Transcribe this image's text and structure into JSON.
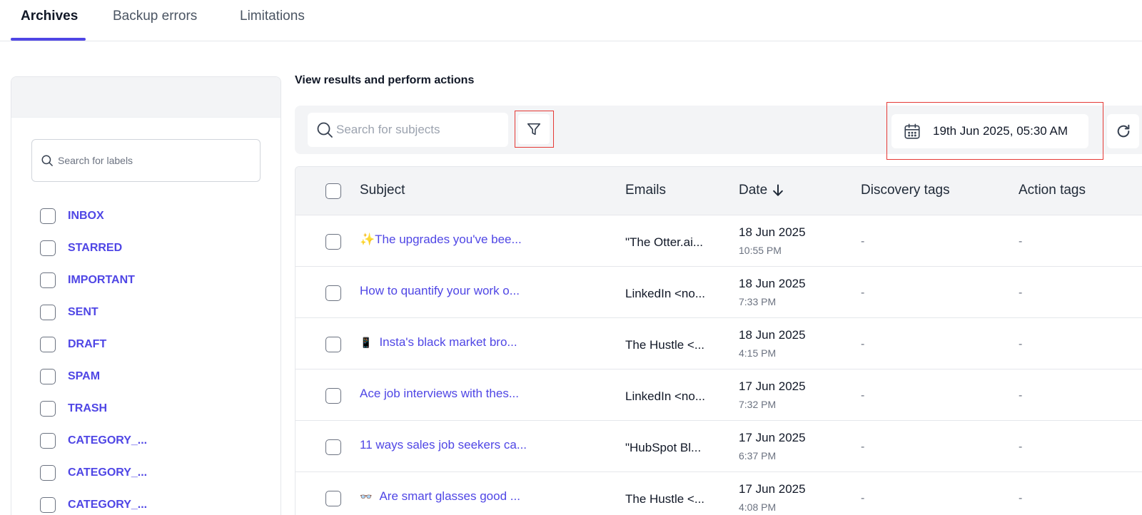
{
  "tabs": [
    {
      "label": "Archives",
      "active": true
    },
    {
      "label": "Backup errors",
      "active": false
    },
    {
      "label": "Limitations",
      "active": false
    }
  ],
  "sidebar": {
    "search_placeholder": "Search for labels",
    "labels": [
      "INBOX",
      "STARRED",
      "IMPORTANT",
      "SENT",
      "DRAFT",
      "SPAM",
      "TRASH",
      "CATEGORY_...",
      "CATEGORY_...",
      "CATEGORY_..."
    ]
  },
  "main": {
    "title": "View results and perform actions",
    "search_placeholder": "Search for subjects",
    "date_value": "19th Jun 2025, 05:30 AM"
  },
  "table": {
    "columns": {
      "subject": "Subject",
      "emails": "Emails",
      "date": "Date",
      "discovery": "Discovery tags",
      "action": "Action tags"
    },
    "rows": [
      {
        "icon": "✨",
        "subject": "The upgrades you've bee...",
        "email": "\"The Otter.ai...",
        "date": "18 Jun 2025",
        "time": "10:55 PM",
        "discovery": "-",
        "action": "-"
      },
      {
        "icon": "",
        "subject": "How to quantify your work o...",
        "email": "LinkedIn <no...",
        "date": "18 Jun 2025",
        "time": "7:33 PM",
        "discovery": "-",
        "action": "-"
      },
      {
        "icon": "📱",
        "subject": "Insta's black market bro...",
        "email": "The Hustle <...",
        "date": "18 Jun 2025",
        "time": "4:15 PM",
        "discovery": "-",
        "action": "-"
      },
      {
        "icon": "",
        "subject": "Ace job interviews with thes...",
        "email": "LinkedIn <no...",
        "date": "17 Jun 2025",
        "time": "7:32 PM",
        "discovery": "-",
        "action": "-"
      },
      {
        "icon": "",
        "subject": "11 ways sales job seekers ca...",
        "email": "\"HubSpot Bl...",
        "date": "17 Jun 2025",
        "time": "6:37 PM",
        "discovery": "-",
        "action": "-"
      },
      {
        "icon": "👓",
        "subject": "Are smart glasses good ...",
        "email": "The Hustle <...",
        "date": "17 Jun 2025",
        "time": "4:08 PM",
        "discovery": "-",
        "action": "-"
      }
    ]
  },
  "icons": {
    "search": "search-icon",
    "filter": "filter-icon",
    "calendar": "calendar-icon",
    "refresh": "refresh-icon",
    "sort": "arrow-down-icon"
  },
  "colors": {
    "accent": "#4f46e5",
    "highlight": "#e53935"
  }
}
